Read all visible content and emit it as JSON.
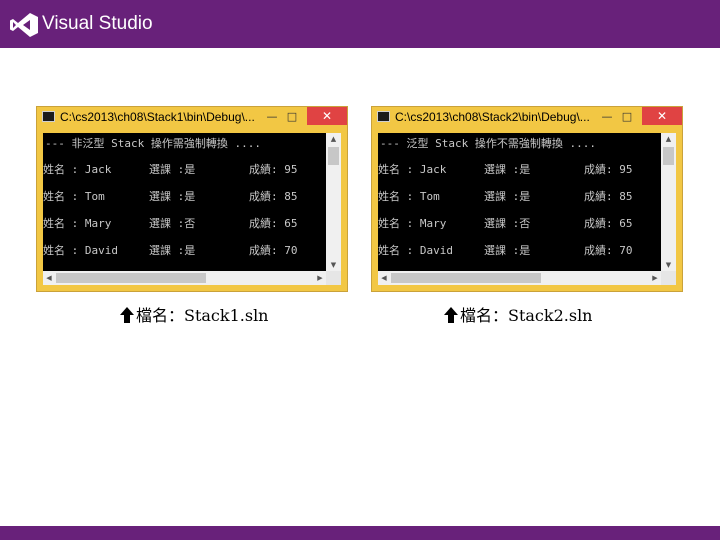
{
  "header": {
    "title": "Visual Studio",
    "brand_color": "#68217a"
  },
  "windows": [
    {
      "title": "C:\\cs2013\\ch08\\Stack1\\bin\\Debug\\...",
      "header_line": "--- 非泛型 Stack 操作需強制轉換 ....",
      "rows": [
        {
          "name": "姓名 : Jack",
          "elective": "選課 :是",
          "score": "成績: 95"
        },
        {
          "name": "姓名 : Tom",
          "elective": "選課 :是",
          "score": "成績: 85"
        },
        {
          "name": "姓名 : Mary",
          "elective": "選課 :否",
          "score": "成績: 65"
        },
        {
          "name": "姓名 : David",
          "elective": "選課 :是",
          "score": "成績: 70"
        }
      ],
      "caption": "檔名：Stack1.sln"
    },
    {
      "title": "C:\\cs2013\\ch08\\Stack2\\bin\\Debug\\...",
      "header_line": "--- 泛型 Stack 操作不需強制轉換 ....",
      "rows": [
        {
          "name": "姓名 : Jack",
          "elective": "選課 :是",
          "score": "成績: 95"
        },
        {
          "name": "姓名 : Tom",
          "elective": "選課 :是",
          "score": "成績: 85"
        },
        {
          "name": "姓名 : Mary",
          "elective": "選課 :否",
          "score": "成績: 65"
        },
        {
          "name": "姓名 : David",
          "elective": "選課 :是",
          "score": "成績: 70"
        }
      ],
      "caption": "檔名：Stack2.sln"
    }
  ],
  "icons": {
    "window_controls": [
      "minimize-icon",
      "maximize-icon",
      "close-icon"
    ],
    "caption_marker": "up-arrow-icon"
  }
}
